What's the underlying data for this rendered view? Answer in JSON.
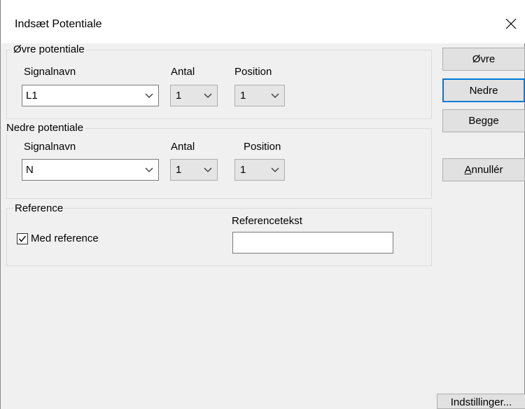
{
  "window": {
    "title": "Indsæt Potentiale"
  },
  "upper": {
    "group_label": "Øvre potentiale",
    "signal_label": "Signalnavn",
    "count_label": "Antal",
    "position_label": "Position",
    "signal_value": "L1",
    "count_value": "1",
    "position_value": "1"
  },
  "lower": {
    "group_label": "Nedre potentiale",
    "signal_label": "Signalnavn",
    "count_label": "Antal",
    "position_label": "Position",
    "signal_value": "N",
    "count_value": "1",
    "position_value": "1"
  },
  "reference": {
    "group_label": "Reference",
    "checkbox_label": "Med reference",
    "checked": true,
    "text_label": "Referencetekst",
    "text_value": ""
  },
  "buttons": {
    "upper": "Øvre",
    "lower": "Nedre",
    "both": "Begge",
    "cancel": "Annullér",
    "settings": "Indstillinger..."
  },
  "icons": {
    "close": "close-icon",
    "dropdown": "chevron-down-icon",
    "check": "checkmark-icon"
  },
  "colors": {
    "focus_border": "#0078d7",
    "dialog_bg": "#f0f0f0"
  }
}
